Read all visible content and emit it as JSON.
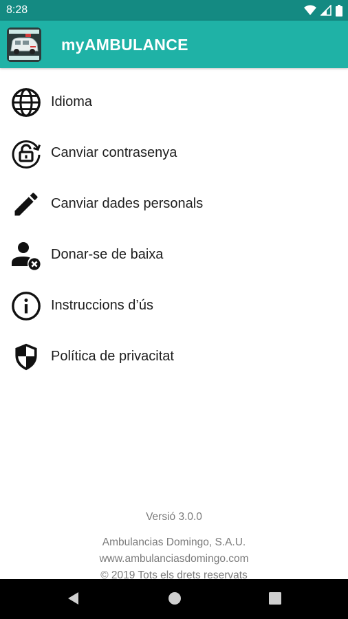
{
  "status_bar": {
    "time": "8:28",
    "icons": [
      "wifi-icon",
      "signal-icon",
      "battery-icon"
    ]
  },
  "app_bar": {
    "title": "myAMBULANCE",
    "background_color": "#1fb2a6",
    "status_color": "#148a82"
  },
  "menu": {
    "items": [
      {
        "label": "Idioma",
        "icon": "globe-icon"
      },
      {
        "label": "Canviar contrasenya",
        "icon": "lock-refresh-icon"
      },
      {
        "label": "Canviar dades personals",
        "icon": "pencil-icon"
      },
      {
        "label": "Donar-se de baixa",
        "icon": "user-remove-icon"
      },
      {
        "label": "Instruccions d’ús",
        "icon": "info-icon"
      },
      {
        "label": "Política de privacitat",
        "icon": "shield-icon"
      }
    ]
  },
  "footer": {
    "version": "Versió 3.0.0",
    "company": "Ambulancias Domingo, S.A.U.",
    "website": "www.ambulanciasdomingo.com",
    "copyright": "© 2019 Tots els drets reservats"
  },
  "nav_bar": {
    "buttons": [
      "back-icon",
      "home-icon",
      "recents-icon"
    ]
  }
}
